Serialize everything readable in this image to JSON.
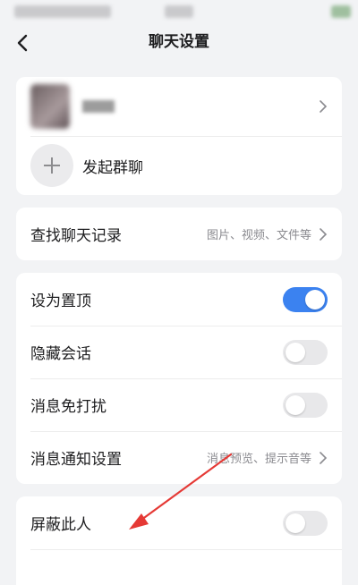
{
  "nav": {
    "title": "聊天设置"
  },
  "group_chat": {
    "start_label": "发起群聊"
  },
  "search_history": {
    "label": "查找聊天记录",
    "hint": "图片、视频、文件等"
  },
  "settings": [
    {
      "id": "pin",
      "label": "设为置顶",
      "on": true
    },
    {
      "id": "hide",
      "label": "隐藏会话",
      "on": false
    },
    {
      "id": "mute",
      "label": "消息免打扰",
      "on": false
    }
  ],
  "notify": {
    "label": "消息通知设置",
    "hint": "消息预览、提示音等"
  },
  "block": {
    "label": "屏蔽此人",
    "on": false
  },
  "colors": {
    "accent": "#3b82f0",
    "annotation_arrow": "#e53935"
  }
}
